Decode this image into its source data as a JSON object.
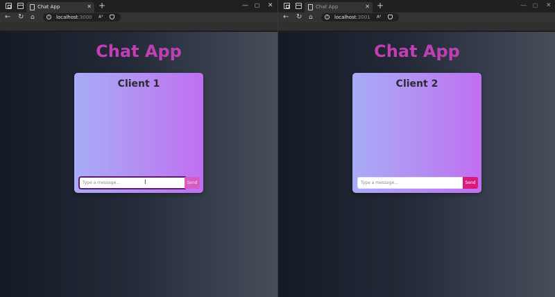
{
  "windows": [
    {
      "tab": {
        "title": "Chat App",
        "close": "✕"
      },
      "new_tab": "+",
      "controls": {
        "minimize": "—",
        "maximize": "☐",
        "close": "✕"
      },
      "address": {
        "host": "localhost",
        "port": ":3000",
        "reader": "A⁴"
      },
      "app_title": "Chat App",
      "client_title": "Client 1",
      "input": {
        "placeholder": "Type a message...",
        "value": "",
        "focused": true
      },
      "send_label": "Send"
    },
    {
      "tab": {
        "title": "Chat App",
        "close": "✕"
      },
      "new_tab": "+",
      "controls": {
        "minimize": "—",
        "maximize": "☐",
        "close": "✕"
      },
      "address": {
        "host": "localhost",
        "port": ":3001",
        "reader": "A⁴"
      },
      "app_title": "Chat App",
      "client_title": "Client 2",
      "input": {
        "placeholder": "Type a message...",
        "value": "",
        "focused": false
      },
      "send_label": "Send"
    }
  ],
  "colors": {
    "accent": "#d81b7c",
    "title": "#c13fb4",
    "card_start": "#a8acf7",
    "card_end": "#c06ff1"
  }
}
